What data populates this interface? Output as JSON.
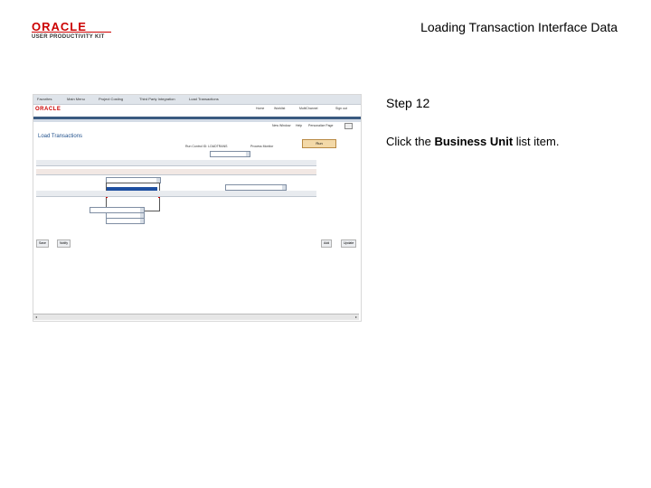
{
  "logo": {
    "brand": "ORACLE",
    "subtitle": "USER PRODUCTIVITY KIT"
  },
  "doc_title": "Loading Transaction Interface Data",
  "step": {
    "label": "Step 12"
  },
  "instruction": {
    "prefix": "Click the ",
    "target": "Business Unit",
    "suffix": " list item."
  },
  "screenshot": {
    "menu_items": [
      "Favorites",
      "Main Menu",
      "Project Costing",
      "Third Party Integration",
      "Load Transactions"
    ],
    "brand": "ORACLE",
    "top_nav": [
      "Home",
      "Worklist",
      "MultiChannel",
      "Sign out"
    ],
    "toolbar": [
      "New Window",
      "Help",
      "Personalize Page"
    ],
    "page_title": "Load Transactions",
    "run_button": "Run",
    "report_manager": "Process Monitor",
    "run_control": "Run Control ID: LOADTRANS",
    "bottom_buttons": [
      "Save",
      "Notify",
      "Add",
      "Update"
    ]
  }
}
